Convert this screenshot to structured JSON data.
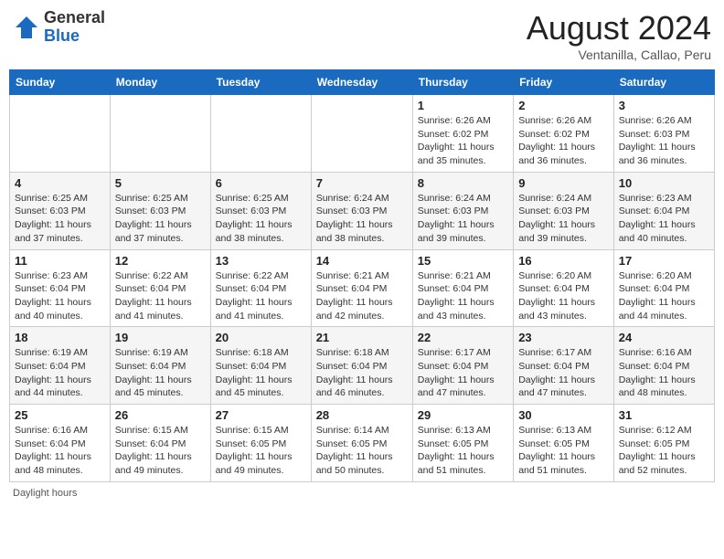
{
  "header": {
    "logo_general": "General",
    "logo_blue": "Blue",
    "month_year": "August 2024",
    "location": "Ventanilla, Callao, Peru"
  },
  "weekdays": [
    "Sunday",
    "Monday",
    "Tuesday",
    "Wednesday",
    "Thursday",
    "Friday",
    "Saturday"
  ],
  "weeks": [
    [
      {
        "day": "",
        "info": ""
      },
      {
        "day": "",
        "info": ""
      },
      {
        "day": "",
        "info": ""
      },
      {
        "day": "",
        "info": ""
      },
      {
        "day": "1",
        "info": "Sunrise: 6:26 AM\nSunset: 6:02 PM\nDaylight: 11 hours and 35 minutes."
      },
      {
        "day": "2",
        "info": "Sunrise: 6:26 AM\nSunset: 6:02 PM\nDaylight: 11 hours and 36 minutes."
      },
      {
        "day": "3",
        "info": "Sunrise: 6:26 AM\nSunset: 6:03 PM\nDaylight: 11 hours and 36 minutes."
      }
    ],
    [
      {
        "day": "4",
        "info": "Sunrise: 6:25 AM\nSunset: 6:03 PM\nDaylight: 11 hours and 37 minutes."
      },
      {
        "day": "5",
        "info": "Sunrise: 6:25 AM\nSunset: 6:03 PM\nDaylight: 11 hours and 37 minutes."
      },
      {
        "day": "6",
        "info": "Sunrise: 6:25 AM\nSunset: 6:03 PM\nDaylight: 11 hours and 38 minutes."
      },
      {
        "day": "7",
        "info": "Sunrise: 6:24 AM\nSunset: 6:03 PM\nDaylight: 11 hours and 38 minutes."
      },
      {
        "day": "8",
        "info": "Sunrise: 6:24 AM\nSunset: 6:03 PM\nDaylight: 11 hours and 39 minutes."
      },
      {
        "day": "9",
        "info": "Sunrise: 6:24 AM\nSunset: 6:03 PM\nDaylight: 11 hours and 39 minutes."
      },
      {
        "day": "10",
        "info": "Sunrise: 6:23 AM\nSunset: 6:04 PM\nDaylight: 11 hours and 40 minutes."
      }
    ],
    [
      {
        "day": "11",
        "info": "Sunrise: 6:23 AM\nSunset: 6:04 PM\nDaylight: 11 hours and 40 minutes."
      },
      {
        "day": "12",
        "info": "Sunrise: 6:22 AM\nSunset: 6:04 PM\nDaylight: 11 hours and 41 minutes."
      },
      {
        "day": "13",
        "info": "Sunrise: 6:22 AM\nSunset: 6:04 PM\nDaylight: 11 hours and 41 minutes."
      },
      {
        "day": "14",
        "info": "Sunrise: 6:21 AM\nSunset: 6:04 PM\nDaylight: 11 hours and 42 minutes."
      },
      {
        "day": "15",
        "info": "Sunrise: 6:21 AM\nSunset: 6:04 PM\nDaylight: 11 hours and 43 minutes."
      },
      {
        "day": "16",
        "info": "Sunrise: 6:20 AM\nSunset: 6:04 PM\nDaylight: 11 hours and 43 minutes."
      },
      {
        "day": "17",
        "info": "Sunrise: 6:20 AM\nSunset: 6:04 PM\nDaylight: 11 hours and 44 minutes."
      }
    ],
    [
      {
        "day": "18",
        "info": "Sunrise: 6:19 AM\nSunset: 6:04 PM\nDaylight: 11 hours and 44 minutes."
      },
      {
        "day": "19",
        "info": "Sunrise: 6:19 AM\nSunset: 6:04 PM\nDaylight: 11 hours and 45 minutes."
      },
      {
        "day": "20",
        "info": "Sunrise: 6:18 AM\nSunset: 6:04 PM\nDaylight: 11 hours and 45 minutes."
      },
      {
        "day": "21",
        "info": "Sunrise: 6:18 AM\nSunset: 6:04 PM\nDaylight: 11 hours and 46 minutes."
      },
      {
        "day": "22",
        "info": "Sunrise: 6:17 AM\nSunset: 6:04 PM\nDaylight: 11 hours and 47 minutes."
      },
      {
        "day": "23",
        "info": "Sunrise: 6:17 AM\nSunset: 6:04 PM\nDaylight: 11 hours and 47 minutes."
      },
      {
        "day": "24",
        "info": "Sunrise: 6:16 AM\nSunset: 6:04 PM\nDaylight: 11 hours and 48 minutes."
      }
    ],
    [
      {
        "day": "25",
        "info": "Sunrise: 6:16 AM\nSunset: 6:04 PM\nDaylight: 11 hours and 48 minutes."
      },
      {
        "day": "26",
        "info": "Sunrise: 6:15 AM\nSunset: 6:04 PM\nDaylight: 11 hours and 49 minutes."
      },
      {
        "day": "27",
        "info": "Sunrise: 6:15 AM\nSunset: 6:05 PM\nDaylight: 11 hours and 49 minutes."
      },
      {
        "day": "28",
        "info": "Sunrise: 6:14 AM\nSunset: 6:05 PM\nDaylight: 11 hours and 50 minutes."
      },
      {
        "day": "29",
        "info": "Sunrise: 6:13 AM\nSunset: 6:05 PM\nDaylight: 11 hours and 51 minutes."
      },
      {
        "day": "30",
        "info": "Sunrise: 6:13 AM\nSunset: 6:05 PM\nDaylight: 11 hours and 51 minutes."
      },
      {
        "day": "31",
        "info": "Sunrise: 6:12 AM\nSunset: 6:05 PM\nDaylight: 11 hours and 52 minutes."
      }
    ]
  ],
  "footer": {
    "daylight_label": "Daylight hours"
  }
}
